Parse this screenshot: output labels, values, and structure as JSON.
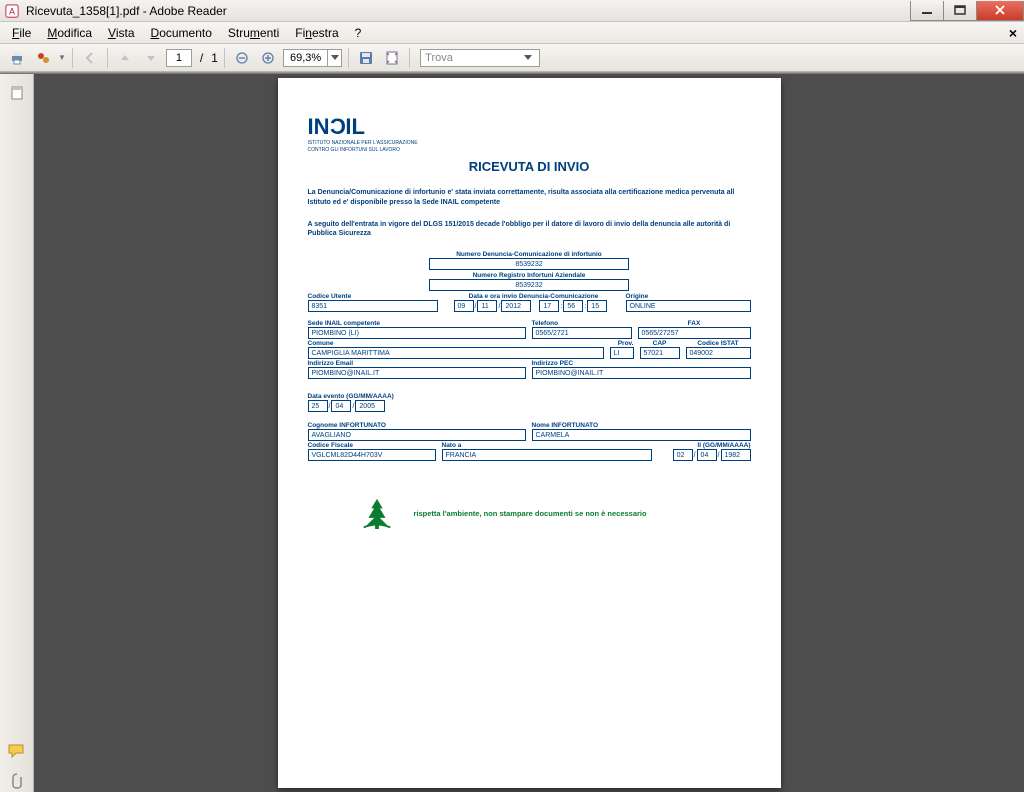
{
  "window": {
    "title": "Ricevuta_1358[1].pdf - Adobe Reader"
  },
  "menu": {
    "file": "File",
    "file_u": "F",
    "modifica": "Modifica",
    "modifica_u": "M",
    "vista": "Vista",
    "vista_u": "V",
    "documento": "Documento",
    "documento_u": "D",
    "strumenti": "Strumenti",
    "strumenti_u": "m",
    "finestra": "Finestra",
    "finestra_u": "n",
    "help": "?"
  },
  "toolbar": {
    "page_current": "1",
    "page_sep": "/",
    "page_total": "1",
    "zoom": "69,3%",
    "search_placeholder": "Trova"
  },
  "doc": {
    "logo": "INAIL",
    "logo_sub1": "ISTITUTO NAZIONALE PER L'ASSICURAZIONE",
    "logo_sub2": "CONTRO GLI INFORTUNI SUL LAVORO",
    "title": "RICEVUTA DI INVIO",
    "para1": "La Denuncia/Comunicazione di infortunio e' stata inviata correttamente, risulta associata alla certificazione medica pervenuta all Istituto ed e' disponibile presso la Sede INAIL competente",
    "para2": "A seguito dell'entrata in vigore del DLGS 151/2015 decade l'obbligo per il datore di lavoro di invio della denuncia alle autorità di Pubblica Sicurezza",
    "lbl_num_denuncia": "Numero Denuncia-Comunicazione di infortunio",
    "val_num_denuncia": "8539232",
    "lbl_num_registro": "Numero Registro Infortuni Aziendale",
    "val_num_registro": "8539232",
    "lbl_codice_utente": "Codice Utente",
    "val_codice_utente": "8351",
    "lbl_data_invio": "Data e ora invio Denuncia-Comunicazione",
    "date_d": "09",
    "date_m": "11",
    "date_y": "2012",
    "time_h": "17",
    "time_m": "56",
    "time_s": "15",
    "lbl_origine": "Origine",
    "val_origine": "ONLINE",
    "lbl_sede": "Sede INAIL competente",
    "val_sede": "PIOMBINO (LI)",
    "lbl_telefono": "Telefono",
    "val_telefono": "0565/2721",
    "lbl_fax": "FAX",
    "val_fax": "0565/27257",
    "lbl_comune": "Comune",
    "val_comune": "CAMPIGLIA MARITTIMA",
    "lbl_prov": "Prov.",
    "val_prov": "LI",
    "lbl_cap": "CAP",
    "val_cap": "57021",
    "lbl_istat": "Codice ISTAT",
    "val_istat": "049002",
    "lbl_email": "Indirizzo Email",
    "val_email": "PIOMBINO@INAIL.IT",
    "lbl_pec": "Indirizzo PEC",
    "val_pec": "PIOMBINO@INAIL.IT",
    "lbl_data_evento": "Data evento (GG/MM/AAAA)",
    "ev_d": "25",
    "ev_m": "04",
    "ev_y": "2005",
    "lbl_cognome": "Cognome INFORTUNATO",
    "val_cognome": "AVAGLIANO",
    "lbl_nome": "Nome INFORTUNATO",
    "val_nome": "CARMELA",
    "lbl_cf": "Codice Fiscale",
    "val_cf": "VGLCML82D44H703V",
    "lbl_nato": "Nato a",
    "val_nato": "FRANCIA",
    "lbl_il": "Il (GG/MM/AAAA)",
    "nato_d": "02",
    "nato_m": "04",
    "nato_y": "1982",
    "eco": "rispetta l'ambiente, non stampare documenti se non è necessario"
  }
}
